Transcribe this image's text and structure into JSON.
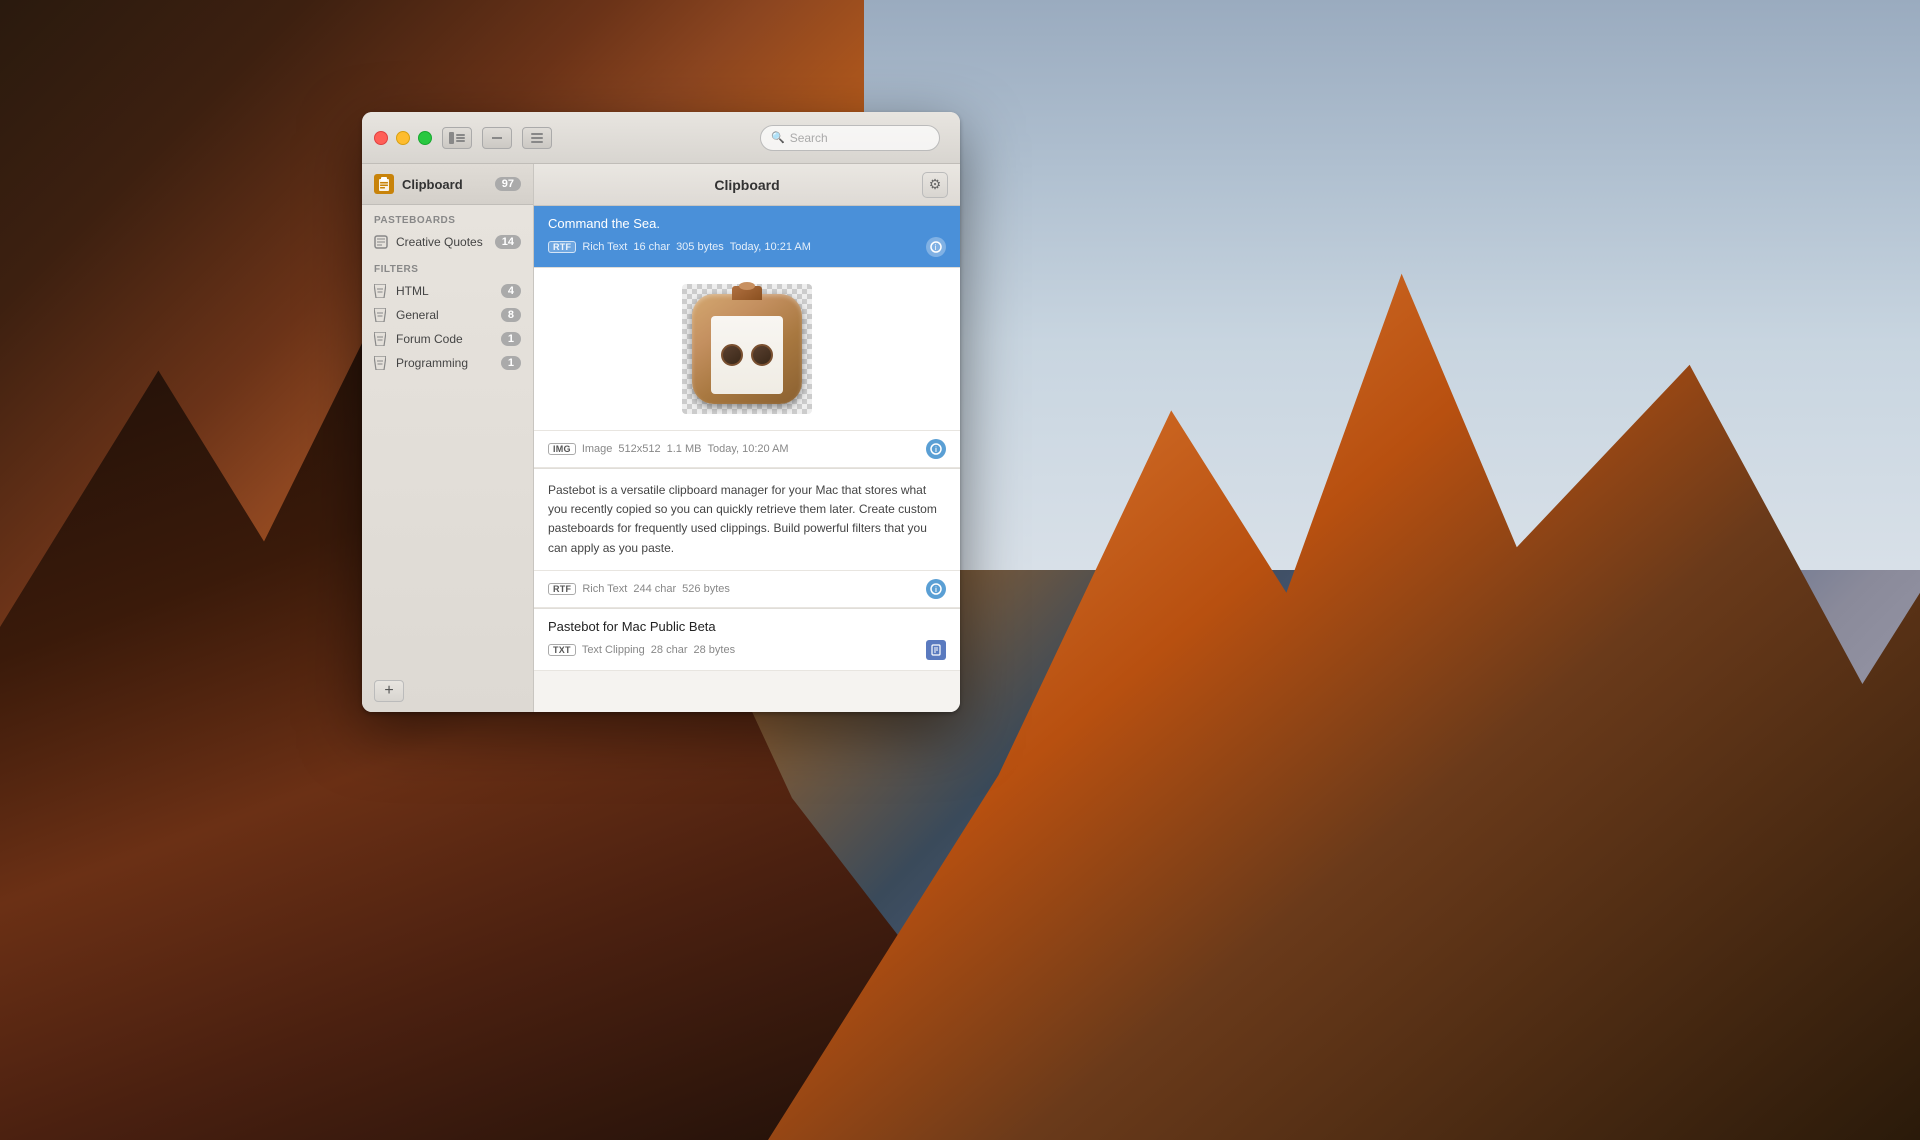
{
  "desktop": {
    "bg_desc": "Yosemite mountains desktop background"
  },
  "window": {
    "title": "Clipboard",
    "traffic_lights": {
      "close_color": "#ff5f57",
      "minimize_color": "#febc2e",
      "maximize_color": "#28c840"
    },
    "titlebar": {
      "sidebar_toggle_label": "⊞",
      "minus_label": "—",
      "menu_label": "≡",
      "search_placeholder": "Search"
    }
  },
  "sidebar": {
    "clipboard_label": "Clipboard",
    "clipboard_badge": "97",
    "sections": {
      "pasteboards_title": "PASTEBOARDS",
      "filters_title": "FILTERS"
    },
    "pasteboards": [
      {
        "icon": "📋",
        "label": "Creative Quotes",
        "badge": "14"
      }
    ],
    "filters": [
      {
        "label": "HTML",
        "badge": "4"
      },
      {
        "label": "General",
        "badge": "8"
      },
      {
        "label": "Forum Code",
        "badge": "1"
      },
      {
        "label": "Programming",
        "badge": "1"
      }
    ],
    "add_button": "+"
  },
  "main_panel": {
    "title": "Clipboard",
    "gear_icon": "⚙",
    "clips": [
      {
        "id": "clip1",
        "selected": true,
        "title": "Command the Sea.",
        "type_badge": "RTF",
        "type_label": "Rich Text",
        "char_count": "16 char",
        "size": "305 bytes",
        "timestamp": "Today, 10:21 AM",
        "has_info": true
      },
      {
        "id": "clip2",
        "selected": false,
        "is_image": true,
        "img_type": "IMG",
        "img_label": "Image",
        "img_dimensions": "512x512",
        "img_size": "1.1 MB",
        "img_timestamp": "Today, 10:20 AM",
        "has_info": true
      },
      {
        "id": "clip3",
        "selected": false,
        "is_text_block": true,
        "text": "Pastebot is a versatile clipboard manager for your Mac that stores what you recently copied so you can quickly retrieve them later. Create custom pasteboards for frequently used clippings. Build powerful filters that you can apply as you paste.",
        "type_badge": "RTF",
        "type_label": "Rich Text",
        "char_count": "244 char",
        "size": "526 bytes",
        "has_info": true
      },
      {
        "id": "clip4",
        "selected": false,
        "title": "Pastebot for Mac Public Beta",
        "type_badge": "TXT",
        "type_label": "Text Clipping",
        "char_count": "28 char",
        "size": "28 bytes",
        "has_file_icon": true
      }
    ]
  }
}
